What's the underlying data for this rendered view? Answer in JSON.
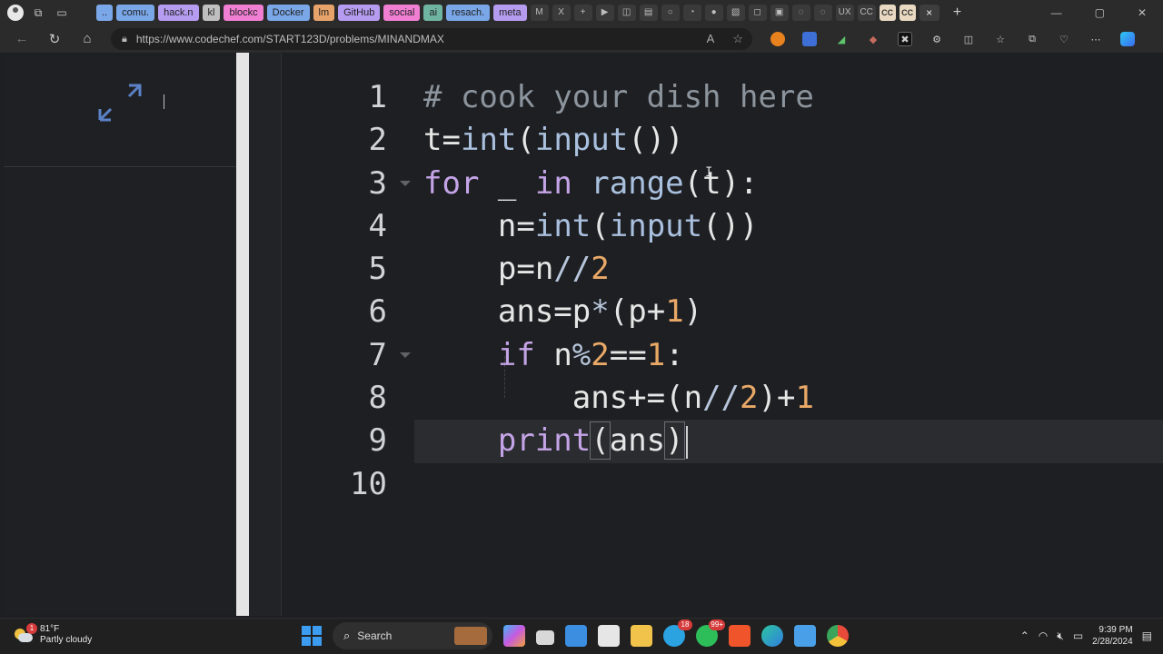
{
  "browser": {
    "tabs": [
      "..",
      "comu.",
      "hack.n",
      "kl",
      "blockc",
      "Docker",
      "lm",
      "GitHub",
      "social",
      "ai",
      "resach.",
      "meta"
    ],
    "tab_colors": [
      "#7aa7e8",
      "#7aa7e8",
      "#b59cf0",
      "#bfbfbf",
      "#f07fd3",
      "#7aa7e8",
      "#e8a36a",
      "#b59cf0",
      "#f07fd3",
      "#6fb4a0",
      "#7aa7e8",
      "#b59cf0"
    ],
    "pinned_tabs": [
      "M",
      "X",
      "+",
      "▶",
      "◫",
      "▤",
      "○",
      "◔",
      "●",
      "▧",
      "◻",
      "▣",
      "◌",
      "◌",
      "UX",
      "CC"
    ],
    "cc_tabs": [
      "CC",
      "CC"
    ],
    "active_tab_close": "×",
    "new_tab": "+",
    "url": "https://www.codechef.com/START123D/problems/MINANDMAX"
  },
  "editor": {
    "line_numbers": [
      "1",
      "2",
      "3",
      "4",
      "5",
      "6",
      "7",
      "8",
      "9",
      "10"
    ]
  },
  "taskbar": {
    "temperature": "81°F",
    "weather": "Partly cloudy",
    "weather_badge": "1",
    "search_placeholder": "Search",
    "telegram_badge": "18",
    "whatsapp_badge": "99+",
    "time": "9:39 PM",
    "date": "2/28/2024"
  },
  "colors": {
    "comment": "#8c949d",
    "keyword": "#c4a4e7",
    "function": "#a9c0de",
    "number": "#e8a867",
    "accent": "#3b9cf0"
  }
}
